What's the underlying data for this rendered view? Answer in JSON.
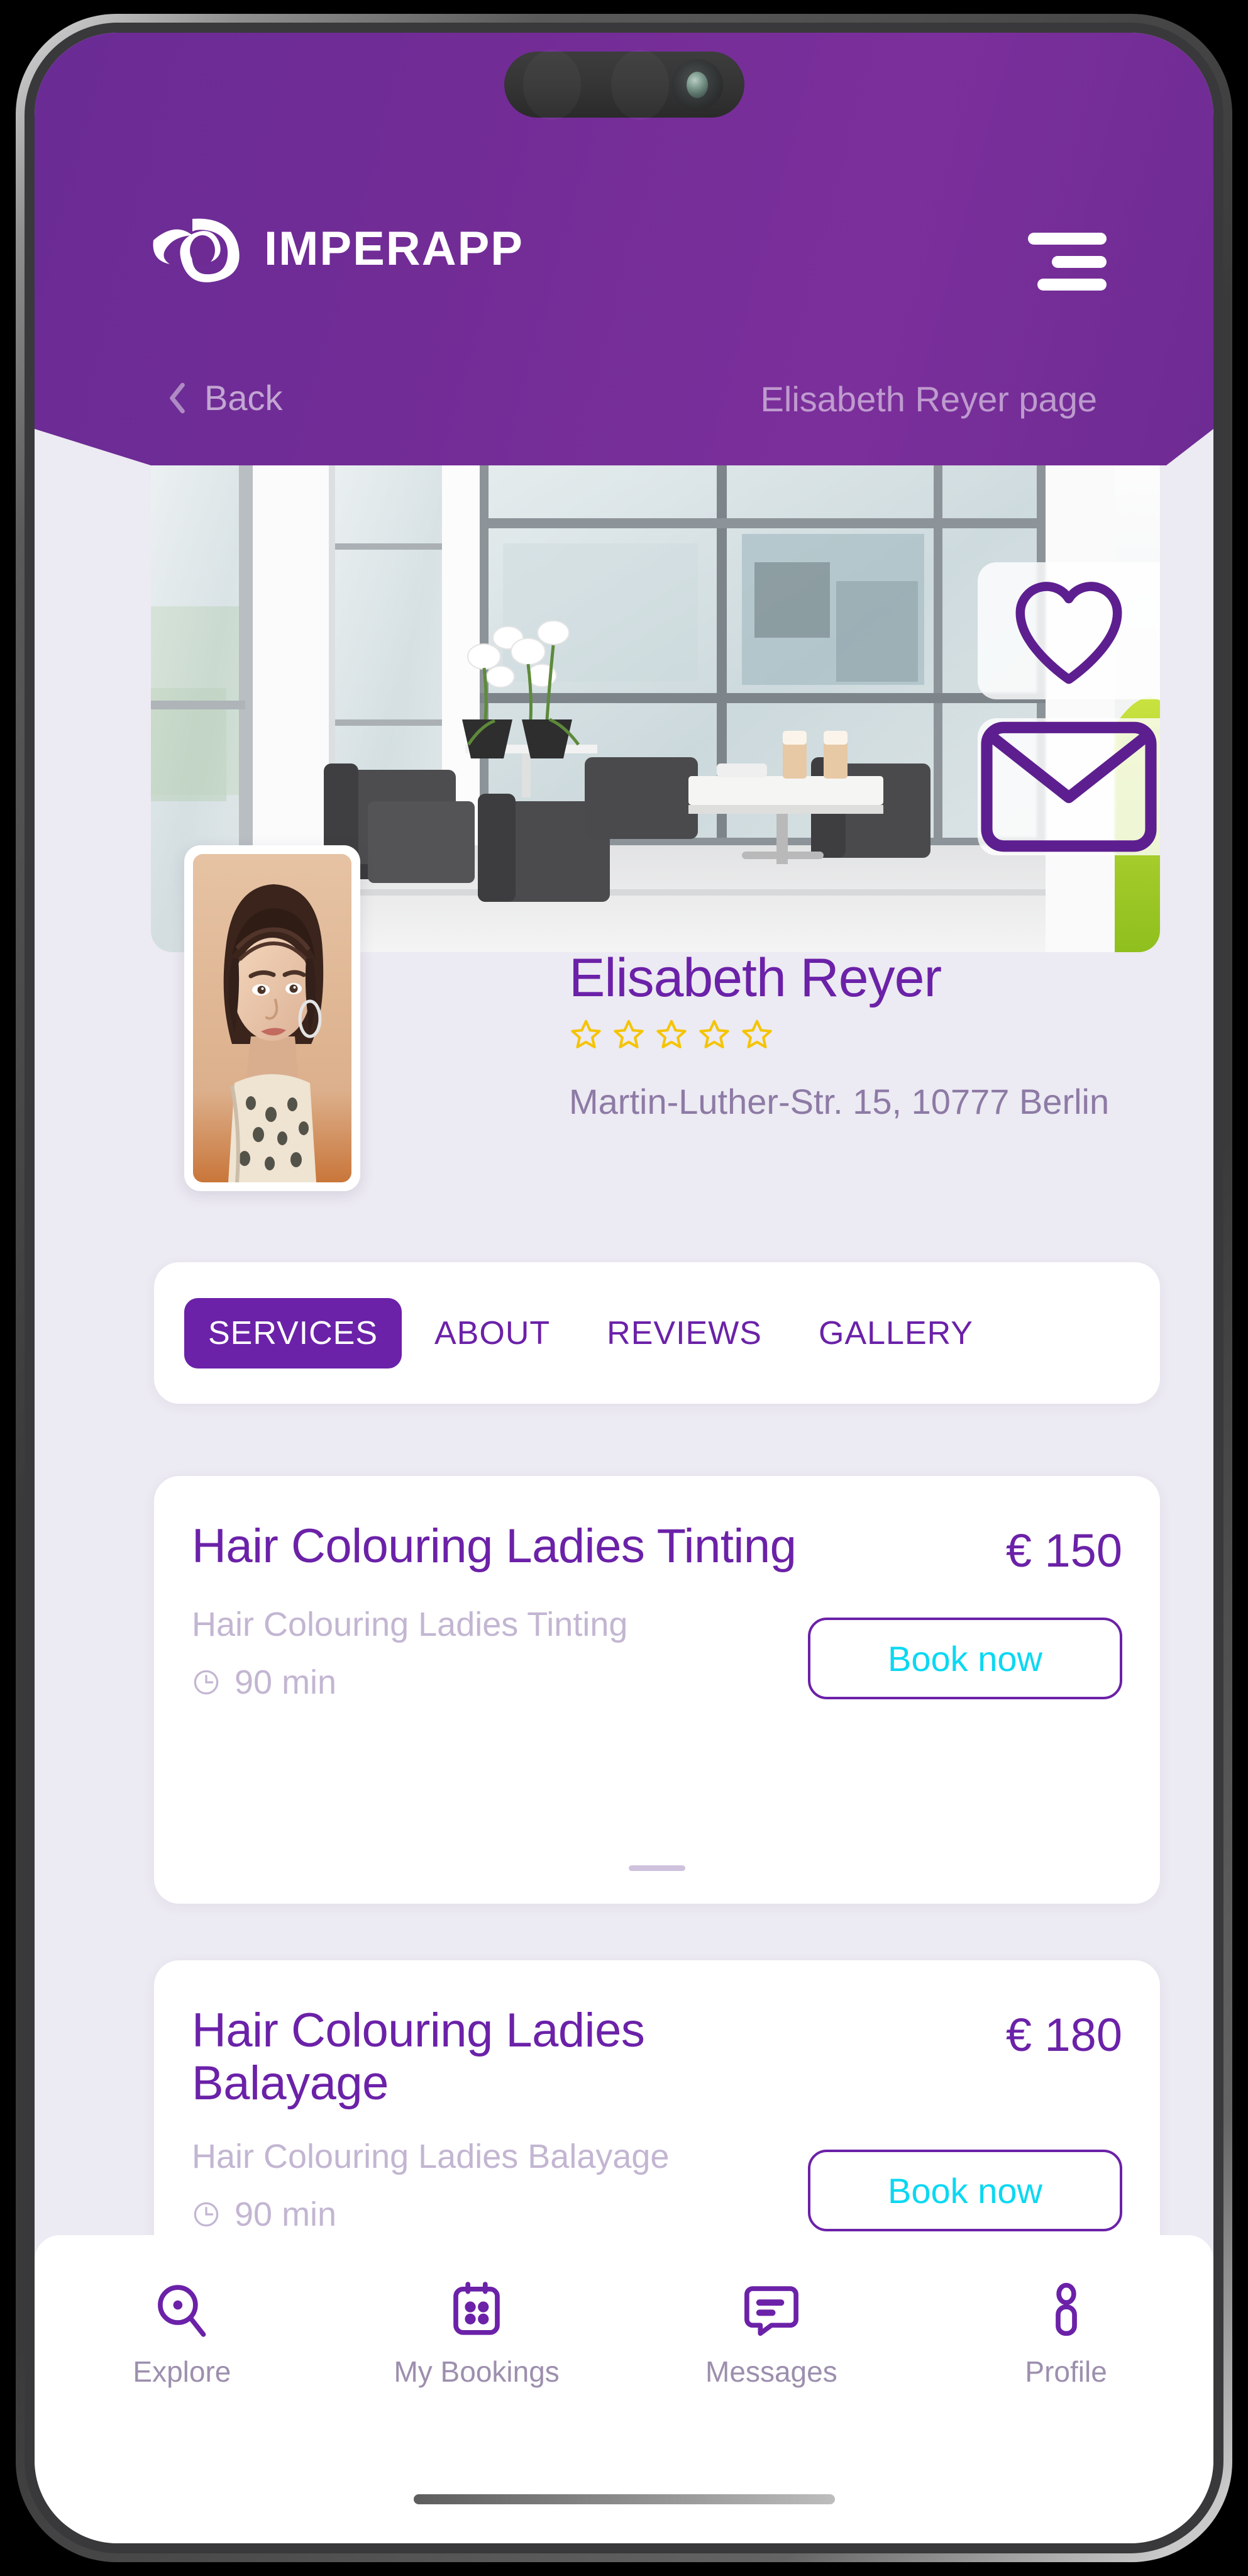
{
  "app": {
    "brand_name": "IMPERAPP",
    "accent_purple": "#6b21a8",
    "header_purple": "#722c96",
    "cyan": "#0ad8f2",
    "star_gold": "#f5c400"
  },
  "header": {
    "logo_icon": "imperapp-swirl-logo",
    "menu_icon": "hamburger-menu-icon",
    "back_icon": "chevron-left-icon",
    "back_label": "Back",
    "page_title": "Elisabeth Reyer page"
  },
  "hero": {
    "image_alt": "salon-interior-photo",
    "actions": [
      {
        "icon": "heart-icon",
        "name": "favorite-button"
      },
      {
        "icon": "envelope-icon",
        "name": "message-button"
      }
    ]
  },
  "profile": {
    "avatar_alt": "elisabeth-reyer-portrait",
    "name": "Elisabeth Reyer",
    "rating_stars": 5,
    "rating_filled": 0,
    "address": "Martin-Luther-Str. 15, 10777 Berlin"
  },
  "tabs": [
    {
      "label": "SERVICES",
      "active": true
    },
    {
      "label": "ABOUT",
      "active": false
    },
    {
      "label": "REVIEWS",
      "active": false
    },
    {
      "label": "GALLERY",
      "active": false
    }
  ],
  "services": [
    {
      "title": "Hair Colouring Ladies Tinting",
      "price": "€ 150",
      "description": "Hair Colouring Ladies Tinting",
      "duration": "90 min",
      "duration_icon": "clock-icon",
      "book_label": "Book now"
    },
    {
      "title": "Hair Colouring Ladies Balayage",
      "price": "€ 180",
      "description": "Hair Colouring Ladies Balayage",
      "duration": "90 min",
      "duration_icon": "clock-icon",
      "book_label": "Book now"
    }
  ],
  "bottom_nav": [
    {
      "label": "Explore",
      "icon": "search-icon"
    },
    {
      "label": "My Bookings",
      "icon": "calendar-icon"
    },
    {
      "label": "Messages",
      "icon": "message-lines-icon"
    },
    {
      "label": "Profile",
      "icon": "person-icon"
    }
  ]
}
